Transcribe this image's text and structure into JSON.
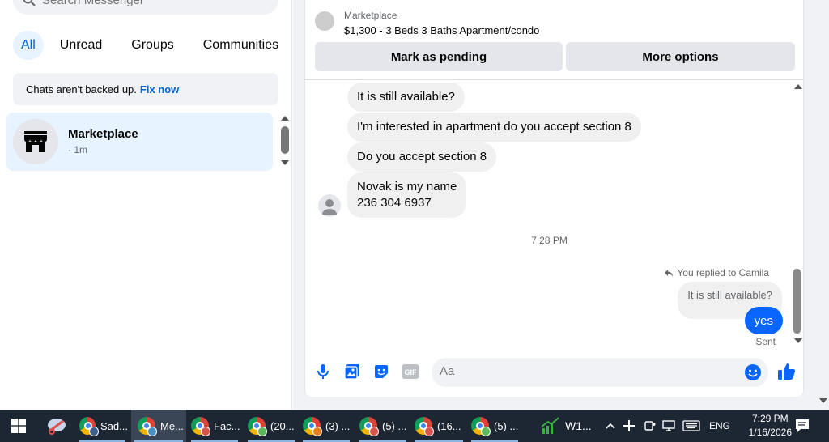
{
  "search": {
    "placeholder": "Search Messenger"
  },
  "filters": [
    {
      "label": "All",
      "active": true
    },
    {
      "label": "Unread",
      "active": false
    },
    {
      "label": "Groups",
      "active": false
    },
    {
      "label": "Communities",
      "active": false
    }
  ],
  "backup_notice": {
    "text": "Chats aren't backed up.",
    "link": "Fix now"
  },
  "chat_list": [
    {
      "name": "Marketplace",
      "meta": "· 1m",
      "icon": "storefront-icon"
    }
  ],
  "listing": {
    "source": "Marketplace",
    "title": "$1,300 - 3 Beds 3 Baths Apartment/condo",
    "buttons": {
      "pending": "Mark as pending",
      "more": "More options"
    }
  },
  "messages": {
    "incoming": [
      "It is still available?",
      "I'm interested in apartment do you accept section 8",
      "Do you accept section 8",
      "Novak is my name",
      "236 304 6937"
    ],
    "timestamp": "7:28 PM",
    "reply_note": "You replied to Camila",
    "quoted": "It is still available?",
    "outgoing": "yes",
    "status": "Sent"
  },
  "composer": {
    "placeholder": "Aa"
  },
  "colors": {
    "accent": "#0866ff",
    "link": "#0064d1",
    "taskbar": "#1d2633"
  },
  "taskbar": {
    "apps": [
      {
        "label": "Sad...",
        "badge": "C",
        "badge_color": "#3b5f8a"
      },
      {
        "label": "Me...",
        "badge": "",
        "badge_color": "#4a90c8",
        "active": true
      },
      {
        "label": "Fac...",
        "badge": "",
        "badge_color": "#d9534f"
      },
      {
        "label": "(20...",
        "badge": "",
        "badge_color": "#5cb85c"
      },
      {
        "label": "(3) ...",
        "badge": "",
        "badge_color": "#e67e22"
      },
      {
        "label": "(5) ...",
        "badge": "",
        "badge_color": "#d9534f"
      },
      {
        "label": "(16...",
        "badge": "",
        "badge_color": "#d9534f"
      },
      {
        "label": "(5) ...",
        "badge": "",
        "badge_color": "#5cb85c"
      }
    ],
    "stock_label": "W1...",
    "language": "ENG",
    "time": "7:29 PM",
    "date": "1/16/2026"
  }
}
